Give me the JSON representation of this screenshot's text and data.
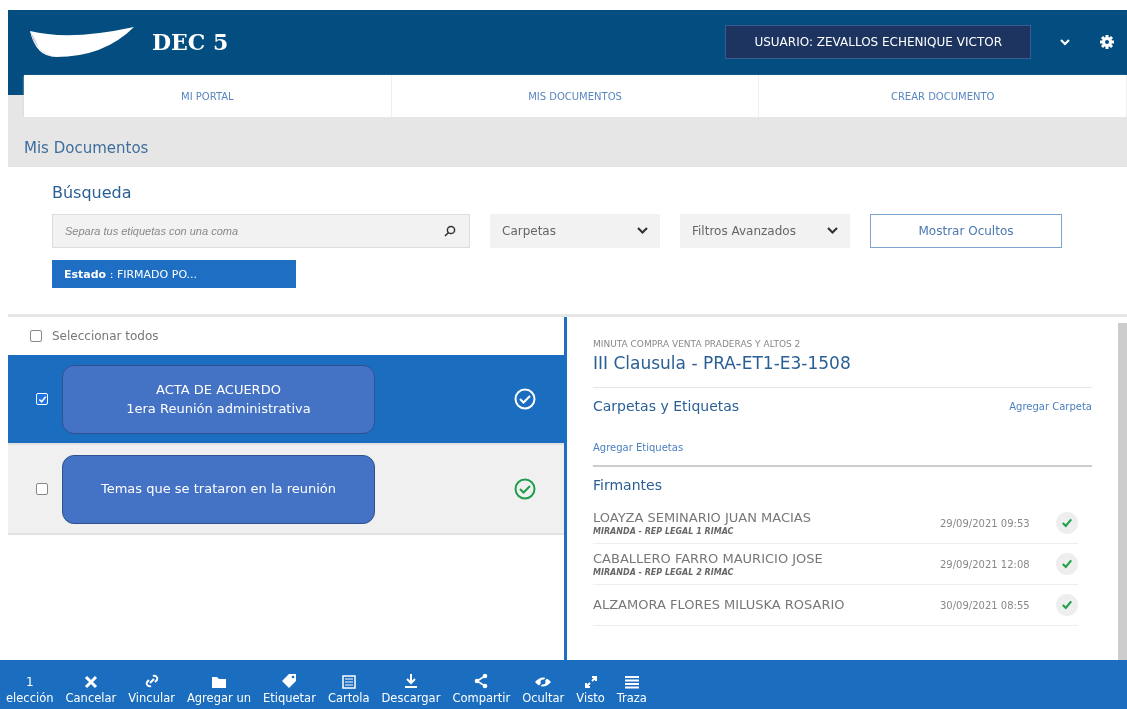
{
  "header": {
    "logo_text": "DEC 5",
    "user": "USUARIO: ZEVALLOS ECHENIQUE VICTOR"
  },
  "nav": [
    "MI PORTAL",
    "MIS DOCUMENTOS",
    "CREAR DOCUMENTO"
  ],
  "page_title": "Mis Documentos",
  "search": {
    "title": "Búsqueda",
    "placeholder": "Separa tus etiquetas con una coma",
    "dropdowns": [
      "Carpetas",
      "Filtros Avanzados"
    ],
    "button": "Mostrar Ocultos",
    "filter_chip": "**Estado** : FIRMADO PO..."
  },
  "list": {
    "select_all": {
      "label": "Seleccionar todos",
      "checked": false
    },
    "items": [
      {
        "selected": true,
        "checked": true,
        "note": [
          "ACTA DE ACUERDO",
          "1era Reunión administrativa"
        ]
      },
      {
        "selected": false,
        "checked": false,
        "note": [
          "Temas que se trataron en la reunión"
        ]
      }
    ]
  },
  "detail": {
    "folder": "MINUTA COMPRA VENTA PRADERAS Y ALTOS 2",
    "title": "III Clausula - PRA-ET1-E3-1508",
    "tags_heading": "Carpetas y Etiquetas",
    "add_folder": "Agregar Carpeta",
    "add_tags": "Agregar Etiquetas",
    "signers_heading": "Firmantes",
    "signers": [
      {
        "name": "LOAYZA SEMINARIO JUAN MACIAS",
        "role": "MIRANDA - REP LEGAL 1 RIMAC",
        "date": "29/09/2021 09:53",
        "signed": true
      },
      {
        "name": "CABALLERO FARRO MAURICIO JOSE",
        "role": "MIRANDA - REP LEGAL 2 RIMAC",
        "date": "29/09/2021 12:08",
        "signed": true
      },
      {
        "name": "ALZAMORA FLORES MILUSKA ROSARIO",
        "date": "30/09/2021 08:55",
        "signed": true
      }
    ]
  },
  "toolbar": [
    {
      "kind": "count",
      "value": "1",
      "label": "elección"
    },
    {
      "kind": "cancel",
      "label": "Cancelar"
    },
    {
      "kind": "link",
      "label": "Vincular"
    },
    {
      "kind": "folder",
      "label": "Agregar un"
    },
    {
      "kind": "tag",
      "label": "Etiquetar"
    },
    {
      "kind": "sheet",
      "label": "Cartola"
    },
    {
      "kind": "download",
      "label": "Descargar"
    },
    {
      "kind": "share",
      "label": "Compartir"
    },
    {
      "kind": "hide",
      "label": "Ocultar"
    },
    {
      "kind": "expand",
      "label": "Visto"
    },
    {
      "kind": "list",
      "label": "Traza"
    }
  ]
}
